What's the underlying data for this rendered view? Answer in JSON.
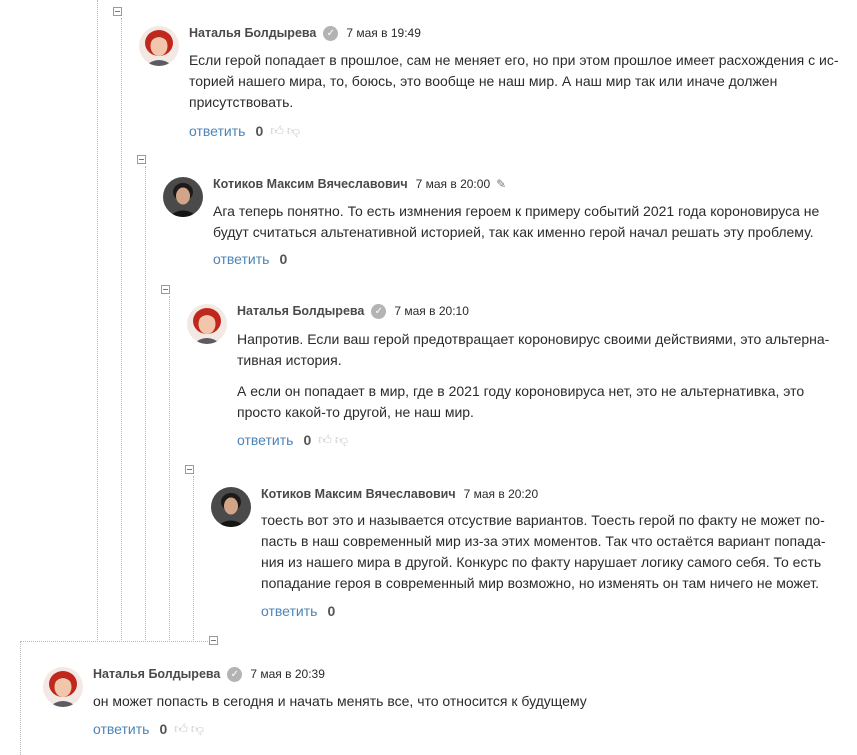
{
  "comments": [
    {
      "author": "Наталья Болдырева",
      "date": "7 мая в 19:49",
      "paragraphs": [
        [
          "Если герой попадает в прошлое, сам не меняет его, но при этом прошлое имеет расхождения с ис-",
          "торией нашего мира, то, боюсь, это вообще не наш мир. А наш мир так или иначе должен",
          "присутствовать."
        ]
      ],
      "reply_label": "ответить",
      "score": "0"
    },
    {
      "author": "Котиков Максим Вячеславович",
      "date": "7 мая в 20:00",
      "paragraphs": [
        [
          "Ага теперь понятно. То есть измнения героем к примеру событий 2021 года короновируса не",
          "будут считаться альтенативной историей, так как именно герой начал решать эту проблему."
        ]
      ],
      "reply_label": "ответить",
      "score": "0"
    },
    {
      "author": "Наталья Болдырева",
      "date": "7 мая в 20:10",
      "paragraphs": [
        [
          "Напротив. Если ваш герой предотвращает короновирус своими действиями, это альтерна-",
          "тивная история."
        ],
        [
          "А если он попадает в мир, где в 2021 году короновируса нет, это не альтернативка, это",
          "просто какой-то другой, не наш мир."
        ]
      ],
      "reply_label": "ответить",
      "score": "0"
    },
    {
      "author": "Котиков Максим Вячеславович",
      "date": "7 мая в 20:20",
      "paragraphs": [
        [
          "тоесть вот это и называется отсуствие вариантов. Тоесть герой  по факту не может по-",
          "пасть в наш современный мир из-за этих моментов. Так что остаётся вариант попада-",
          "ния из нашего мира в другой. Конкурс по факту нарушает логику самого себя. То есть",
          "попадание героя в современный мир возможно, но изменять он там ничего не может."
        ]
      ],
      "reply_label": "ответить",
      "score": "0"
    },
    {
      "author": "Наталья Болдырева",
      "date": "7 мая в 20:39",
      "paragraphs": [
        [
          "он может попасть в сегодня и начать менять все, что относится к будущему"
        ]
      ],
      "reply_label": "ответить",
      "score": "0"
    }
  ],
  "icons": {
    "verified": "check-icon",
    "edit": "pencil-icon",
    "like": "thumbs-up-icon",
    "dislike": "thumbs-down-icon",
    "collapse": "minus-box-icon"
  },
  "colors": {
    "reply_link": "#4e84b5",
    "verified_badge": "#b3b3b3",
    "vote_icon": "#c9c9c9"
  }
}
